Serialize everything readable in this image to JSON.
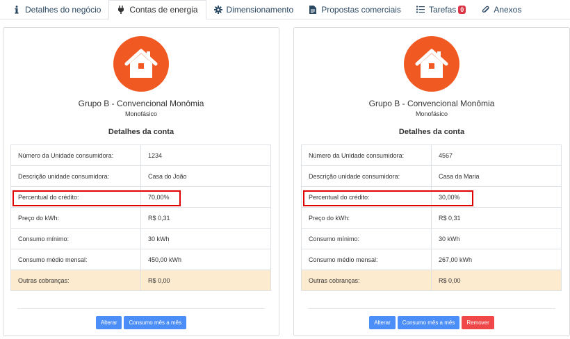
{
  "tabs": [
    {
      "label": "Detalhes do negócio",
      "icon": "info-icon"
    },
    {
      "label": "Contas de energia",
      "icon": "plug-icon"
    },
    {
      "label": "Dimensionamento",
      "icon": "gear-icon"
    },
    {
      "label": "Propostas comerciais",
      "icon": "document-icon"
    },
    {
      "label": "Tarefas",
      "icon": "list-icon",
      "badge": "0"
    },
    {
      "label": "Anexos",
      "icon": "paperclip-icon"
    }
  ],
  "cards": [
    {
      "group": "Grupo B - Convencional Monômia",
      "phase": "Monofásico",
      "section_title": "Detalhes da conta",
      "rows": [
        {
          "label": "Número da Unidade consumidora:",
          "value": "1234"
        },
        {
          "label": "Descrição unidade consumidora:",
          "value": "Casa do João"
        },
        {
          "label": "Percentual do crédito:",
          "value": "70,00%"
        },
        {
          "label": "Preço do kWh:",
          "value": "R$ 0,31"
        },
        {
          "label": "Consumo mínimo:",
          "value": "30 kWh"
        },
        {
          "label": "Consumo médio mensal:",
          "value": "450,00 kWh"
        },
        {
          "label": "Outras cobranças:",
          "value": "R$ 0,00"
        }
      ],
      "buttons": {
        "alter": "Alterar",
        "monthly": "Consumo mês a mês"
      }
    },
    {
      "group": "Grupo B - Convencional Monômia",
      "phase": "Monofásico",
      "section_title": "Detalhes da conta",
      "rows": [
        {
          "label": "Número da Unidade consumidora:",
          "value": "4567"
        },
        {
          "label": "Descrição unidade consumidora:",
          "value": "Casa da Maria"
        },
        {
          "label": "Percentual do crédito:",
          "value": "30,00%"
        },
        {
          "label": "Preço do kWh:",
          "value": "R$ 0,31"
        },
        {
          "label": "Consumo mínimo:",
          "value": "30 kWh"
        },
        {
          "label": "Consumo médio mensal:",
          "value": "267,00 kWh"
        },
        {
          "label": "Outras cobranças:",
          "value": "R$ 0,00"
        }
      ],
      "buttons": {
        "alter": "Alterar",
        "monthly": "Consumo mês a mês",
        "remove": "Remover"
      }
    }
  ],
  "colors": {
    "accent": "#f05a22",
    "primary_button": "#4c8ef7",
    "danger_button": "#f04848",
    "highlight": "#e00000",
    "warning_row": "#fdebd0"
  }
}
